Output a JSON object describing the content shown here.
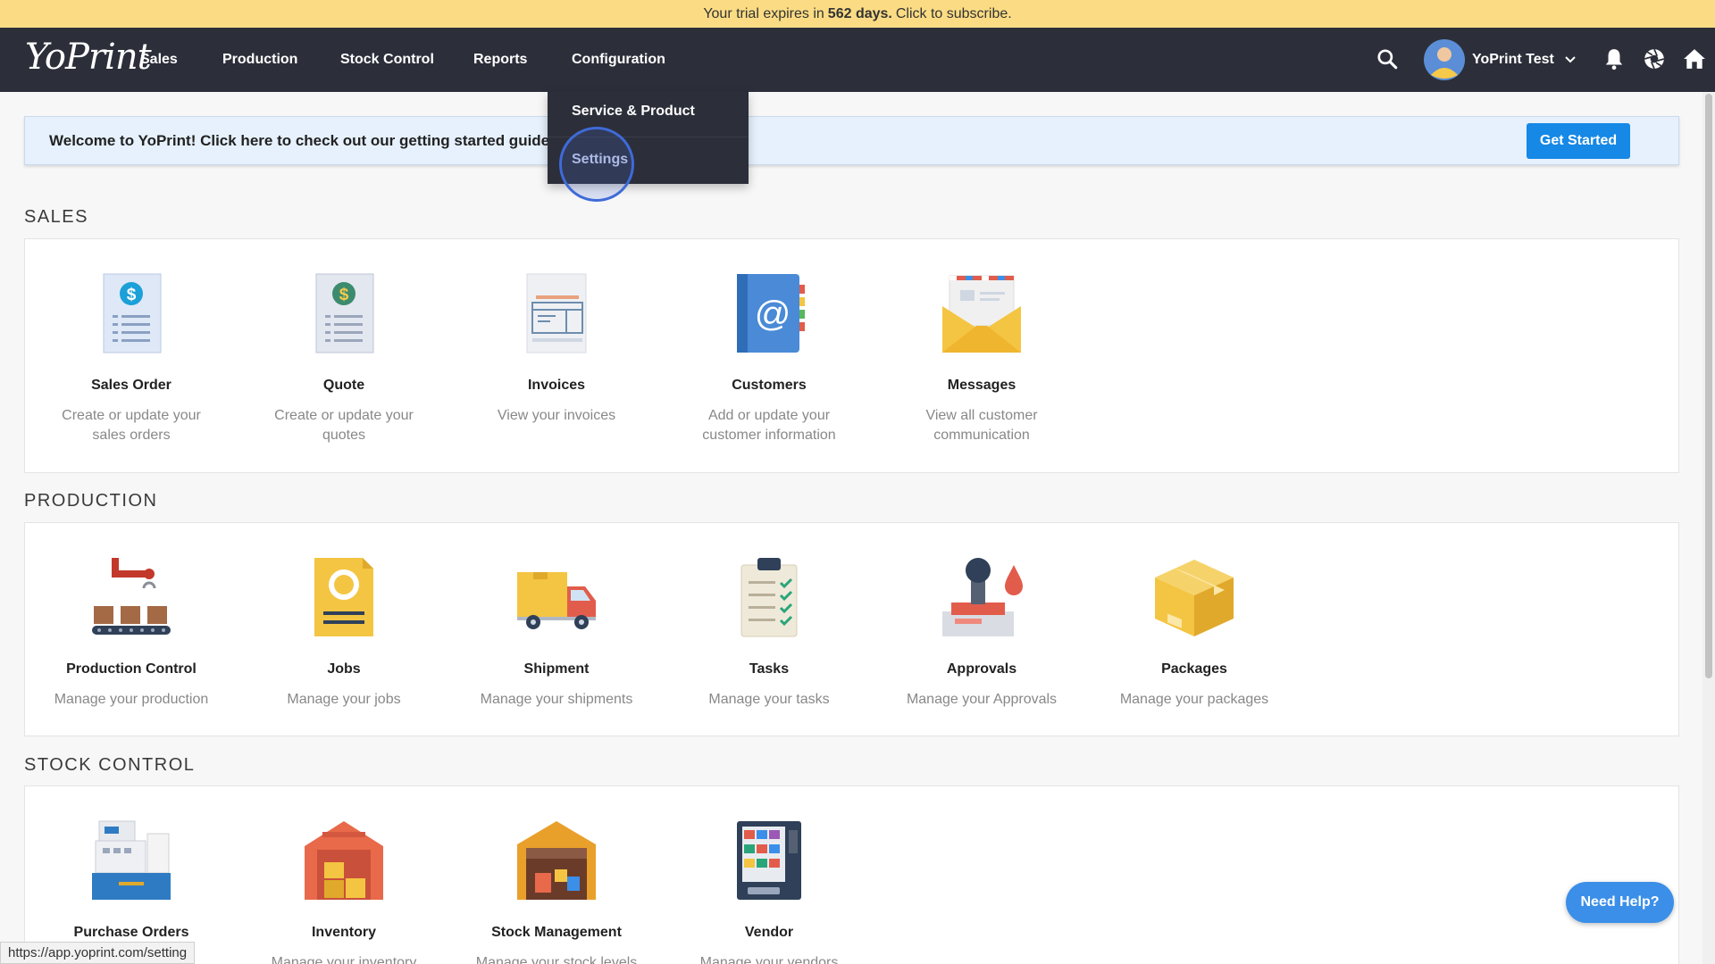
{
  "trial": {
    "prefix": "Your trial expires in",
    "days": "562 days.",
    "suffix": "Click to subscribe."
  },
  "nav": {
    "logo": "YoPrint",
    "items": [
      "Sales",
      "Production",
      "Stock Control",
      "Reports",
      "Configuration"
    ],
    "user": "YoPrint Test"
  },
  "dropdown": {
    "items": [
      "Service & Product",
      "Settings"
    ]
  },
  "welcome": {
    "text": "Welcome to YoPrint! Click here to check out our getting started guide",
    "button": "Get Started"
  },
  "sections": {
    "sales": {
      "title": "SALES",
      "tiles": [
        {
          "name": "Sales Order",
          "desc": "Create or update your sales orders",
          "icon": "sales-order-icon"
        },
        {
          "name": "Quote",
          "desc": "Create or update your quotes",
          "icon": "quote-icon"
        },
        {
          "name": "Invoices",
          "desc": "View your invoices",
          "icon": "invoice-icon"
        },
        {
          "name": "Customers",
          "desc": "Add or update your customer information",
          "icon": "customers-icon"
        },
        {
          "name": "Messages",
          "desc": "View all customer communication",
          "icon": "messages-icon"
        }
      ]
    },
    "production": {
      "title": "PRODUCTION",
      "tiles": [
        {
          "name": "Production Control",
          "desc": "Manage your production",
          "icon": "production-control-icon"
        },
        {
          "name": "Jobs",
          "desc": "Manage your jobs",
          "icon": "jobs-icon"
        },
        {
          "name": "Shipment",
          "desc": "Manage your shipments",
          "icon": "shipment-icon"
        },
        {
          "name": "Tasks",
          "desc": "Manage your tasks",
          "icon": "tasks-icon"
        },
        {
          "name": "Approvals",
          "desc": "Manage your Approvals",
          "icon": "approvals-icon"
        },
        {
          "name": "Packages",
          "desc": "Manage your packages",
          "icon": "packages-icon"
        }
      ]
    },
    "stock": {
      "title": "STOCK CONTROL",
      "tiles": [
        {
          "name": "Purchase Orders",
          "desc": "",
          "icon": "purchase-orders-icon"
        },
        {
          "name": "Inventory",
          "desc": "Manage your inventory",
          "icon": "inventory-icon"
        },
        {
          "name": "Stock Management",
          "desc": "Manage your stock levels",
          "icon": "stock-management-icon"
        },
        {
          "name": "Vendor",
          "desc": "Manage your vendors",
          "icon": "vendor-icon"
        }
      ]
    }
  },
  "help": "Need Help?",
  "status_url": "https://app.yoprint.com/setting",
  "colors": {
    "trial_bar": "#fbdc84",
    "nav": "#2c2f3a",
    "primary": "#1688e5",
    "welcome_bg": "#e6f1fd"
  }
}
